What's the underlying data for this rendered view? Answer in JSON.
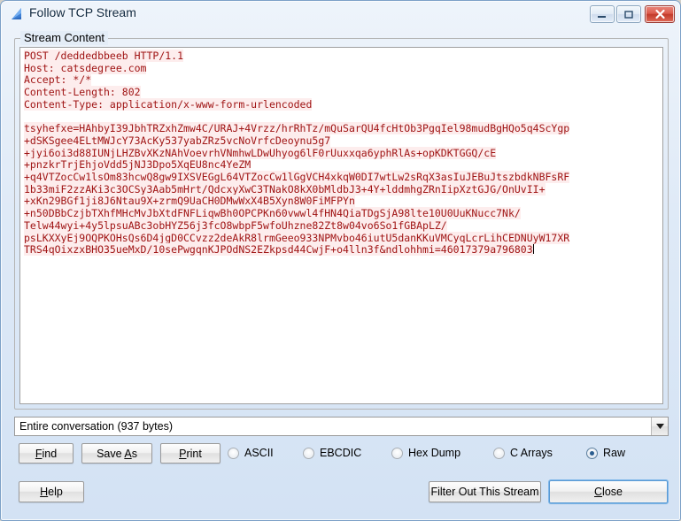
{
  "window": {
    "title": "Follow TCP Stream",
    "icon": "wireshark-shark-fin-icon",
    "minimize_label": "─",
    "maximize_label": "□",
    "close_label": "✕"
  },
  "group": {
    "legend": "Stream Content"
  },
  "stream": {
    "lines": [
      "POST /deddedbbeeb HTTP/1.1",
      "Host: catsdegree.com",
      "Accept: */*",
      "Content-Length: 802",
      "Content-Type: application/x-www-form-urlencoded",
      "",
      "tsyhefxe=HAhbyI39JbhTRZxhZmw4C/URAJ+4Vrzz/hrRhTz/mQuSarQU4fcHtOb3PgqIel98mudBgHQo5q4ScYgp",
      "+dSKSgee4ELtMWJcY73AcKy537yabZRz5vcNoVrfcDeoynu5g7",
      "+jyi6oi3d88IUNjLHZBvXKzNAhVoevrhVNmhwLDwUhyog6lF0rUuxxqa6yphRlAs+opKDKTGGQ/cE",
      "+pnzkrTrjEhjoVdd5jNJ3Dpo5XqEU8nc4YeZM",
      "+q4VTZocCw1lsOm83hcwQ8gw9IXSVEGgL64VTZocCw1lGgVCH4xkqW0DI7wtLw2sRqX3asIuJEBuJtszbdkNBFsRF",
      "1b33miF2zzAKi3c3OCSy3Aab5mHrt/QdcxyXwC3TNakO8kX0bMldbJ3+4Y+lddmhgZRnIipXztGJG/OnUvII+",
      "+xKn29BGf1ji8J6Ntau9X+zrmQ9UaCH0DMwWxX4B5Xyn8W0FiMFPYn",
      "+n50DBbCzjbTXhfMHcMvJbXtdFNFLiqwBh0OPCPKn60vwwl4fHN4QiaTDgSjA98lte10U0UuKNucc7Nk/",
      "Telw44wyi+4y5lpsuABc3obHYZ56j3fcO8wbpF5wfoUhzne82Zt8w04vo6So1fGBApLZ/",
      "psLKXXyEj9OQPKOHsQs6D4jgD0CCvzz2deAkR8lrmGeeo933NPMvbo46iutU5danKKuVMCyqLcrLihCEDNUyW17XR",
      "TRS4qOixzxBHO35ueMxD/10sePwgqnKJPOdNS2EZkpsd44CwjF+o4lln3f&ndlohhmi=46017379a796803"
    ],
    "text_color": "#a01515",
    "highlight_color": "#fdeded"
  },
  "combo": {
    "value": "Entire conversation (937 bytes)",
    "arrow": "▼"
  },
  "buttons": {
    "find": {
      "pre": "",
      "mnemonic": "F",
      "post": "ind"
    },
    "save_as": {
      "pre": "Save ",
      "mnemonic": "A",
      "post": "s"
    },
    "print": {
      "pre": "",
      "mnemonic": "P",
      "post": "rint"
    },
    "help": {
      "pre": "",
      "mnemonic": "H",
      "post": "elp"
    },
    "filter_out": {
      "label": "Filter Out This Stream"
    },
    "close": {
      "pre": "",
      "mnemonic": "C",
      "post": "lose"
    }
  },
  "format_options": [
    {
      "label": "ASCII",
      "selected": false
    },
    {
      "label": "EBCDIC",
      "selected": false
    },
    {
      "label": "Hex Dump",
      "selected": false
    },
    {
      "label": "C Arrays",
      "selected": false
    },
    {
      "label": "Raw",
      "selected": true
    }
  ]
}
